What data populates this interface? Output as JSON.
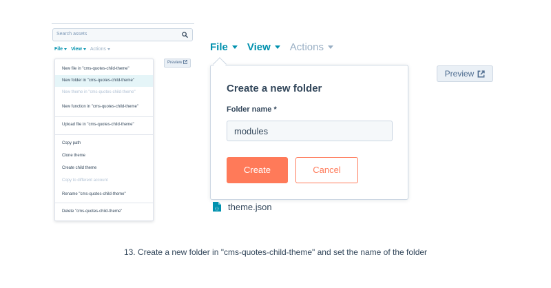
{
  "sidebar": {
    "search_placeholder": "Search assets",
    "menu": [
      "File",
      "View",
      "Actions"
    ],
    "preview_label": "Preview",
    "dropdown": [
      "New file in \"cms-quotes-child-theme\"",
      "New folder in \"cms-quotes-child-theme\"",
      "New theme in \"cms-quotes-child-theme\"",
      "New function in \"cms-quotes-child-theme\"",
      "Upload file in \"cms-quotes-child-theme\"",
      "Copy path",
      "Clone theme",
      "Create child theme",
      "Copy to different account",
      "Rename \"cms-quotes-child-theme\"",
      "Delete \"cms-quotes-child-theme\""
    ]
  },
  "zoom": {
    "menu": [
      "File",
      "View",
      "Actions"
    ],
    "preview_label": "Preview",
    "dialog": {
      "title": "Create a new folder",
      "field_label": "Folder name *",
      "field_value": "modules",
      "create_label": "Create",
      "cancel_label": "Cancel"
    },
    "file_name": "theme.json"
  },
  "caption": "13. Create a new folder in \"cms-quotes-child-theme\" and set the name of the folder",
  "colors": {
    "accent": "#0091ae",
    "primary_button": "#ff7a59",
    "text": "#33475b",
    "muted": "#99afc4"
  },
  "icons": [
    "search-icon",
    "caret-down-icon",
    "external-link-icon",
    "file-json-icon"
  ]
}
